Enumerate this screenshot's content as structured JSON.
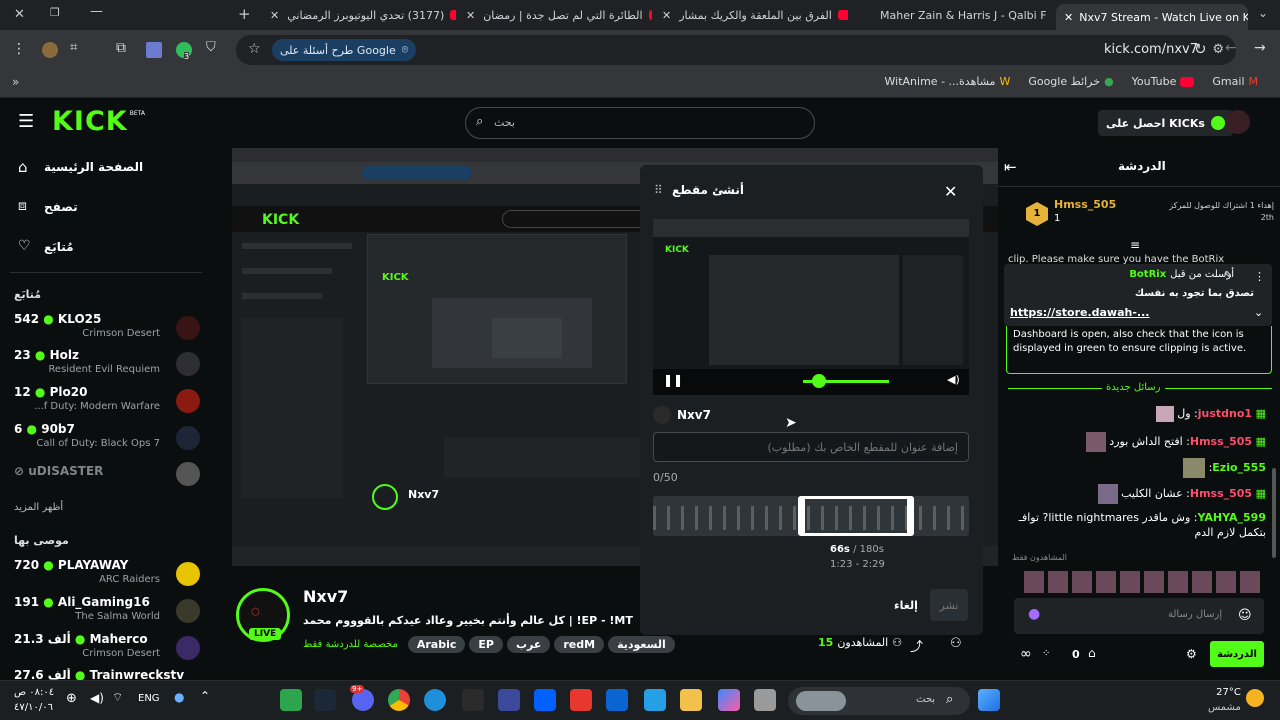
{
  "browser": {
    "tabs": [
      {
        "label": "(3177) تحدي اليوتيوبرز الرمضاني"
      },
      {
        "label": "الطائرة التي لم تصل جدة | رمضان"
      },
      {
        "label": "الفرق بين الملعقة والكريك بمشار"
      },
      {
        "label": "Maher Zain & Harris J - Qalbi F"
      },
      {
        "label": "Nxv7 Stream - Watch Live on K"
      }
    ],
    "url": "kick.com/nxv7",
    "google_chip": "طرح أسئلة على Google",
    "extension_badge": "3",
    "bookmarks": [
      "Gmail",
      "YouTube",
      "خرائط Google",
      "مشاهدة... - WitAnime"
    ]
  },
  "kick": {
    "logo": "KICK",
    "beta": "BETA",
    "search_placeholder": "بحث",
    "get_kicks": "احصل على KICKs",
    "nav": {
      "home": "الصفحة الرئيسية",
      "browse": "تصفح",
      "following": "مُتابَع"
    },
    "following_heading": "مُتابَع",
    "following": [
      {
        "count": "542",
        "name": "KLO25",
        "game": "Crimson Desert"
      },
      {
        "count": "23",
        "name": "Holz",
        "game": "Resident Evil Requiem"
      },
      {
        "count": "12",
        "name": "Plo20",
        "game": "...f Duty: Modern Warfare"
      },
      {
        "count": "6",
        "name": "90b7",
        "game": "Call of Duty: Black Ops 7"
      }
    ],
    "offline": {
      "name": "uDISASTER"
    },
    "show_more": "أظهر المزيد",
    "recommended_heading": "موصى بها",
    "recommended": [
      {
        "count": "720",
        "name": "PLAYAWAY",
        "game": "ARC Raiders"
      },
      {
        "count": "191",
        "name": "Ali_Gaming16",
        "game": "The Salma World"
      },
      {
        "count": "21.3 ألف",
        "name": "Maherco",
        "game": "Crimson Desert"
      },
      {
        "count": "27.6 ألف",
        "name": "Trainwreckstv",
        "game": ""
      }
    ]
  },
  "stream": {
    "channel": "Nxv7",
    "live_badge": "LIVE",
    "title": "كل عالم وأنتم بخيير وعااد عيدكم بالقوووم محمد | !EP - !MT",
    "category": "مخصصة للدردشة فقط",
    "tags": [
      "Arabic",
      "EP",
      "عرب",
      "redM",
      "السعودية"
    ],
    "viewers_label": "المشاهدون",
    "viewers": "15"
  },
  "clip": {
    "title": "أنشئ مقطع",
    "channel": "Nxv7",
    "title_placeholder": "إضافة عنوان للمقطع الخاص بك (مطلوب)",
    "char_count": "0/50",
    "duration": "66s",
    "max_duration": "/ 180s",
    "range": "1:23 - 2:29",
    "publish": "نشر",
    "cancel": "إلغاء"
  },
  "chat": {
    "heading": "الدردشة",
    "gifter": {
      "name": "Hmss_505",
      "count": "1",
      "rank_text": "إهداء 1 اشتراك للوصول للمركز 2th"
    },
    "pinned": {
      "by_label": "أرسلت من قبل",
      "bot": "BotRix",
      "text": "تصدق بما تجود به نفسك",
      "link": "https://store.dawah-..."
    },
    "notice_top": "clip. Please make sure you have the BotRix",
    "notice": "Dashboard is open, also check that the icon is displayed in green to ensure clipping is active.",
    "new_messages": "رسائل جديدة",
    "messages": [
      {
        "user": "justdno1",
        "text": "ول",
        "color": "#ff4d6d"
      },
      {
        "user": "Hmss_505",
        "text": "افتح الداش بورد",
        "color": "#ff4d6d"
      },
      {
        "user": "Ezio_555",
        "text": "",
        "color": "#53fc18"
      },
      {
        "user": "Hmss_505",
        "text": "عشان الكليب",
        "color": "#ff4d6d"
      },
      {
        "user": "YAHYA_599",
        "text": "وش ماقدر little nightmares? توافـ بتكمل لازم الدم",
        "color": "#53fc18"
      }
    ],
    "viewers_only": "المشاهدون فقط",
    "input_placeholder": "إرسال رسالة",
    "send_label": "الدردشة",
    "kicks_count": "0"
  },
  "taskbar": {
    "weather_temp": "27°C",
    "weather_desc": "مشمس",
    "search": "بحث",
    "lang": "ENG",
    "time": "٠٨:٠٤ ص",
    "date": "٤٧/١٠/٠٦",
    "discord_badge": "9+"
  },
  "colors": {
    "kick_green": "#53fc18",
    "bg": "#0b0e0f",
    "modal": "#1b1f22"
  }
}
